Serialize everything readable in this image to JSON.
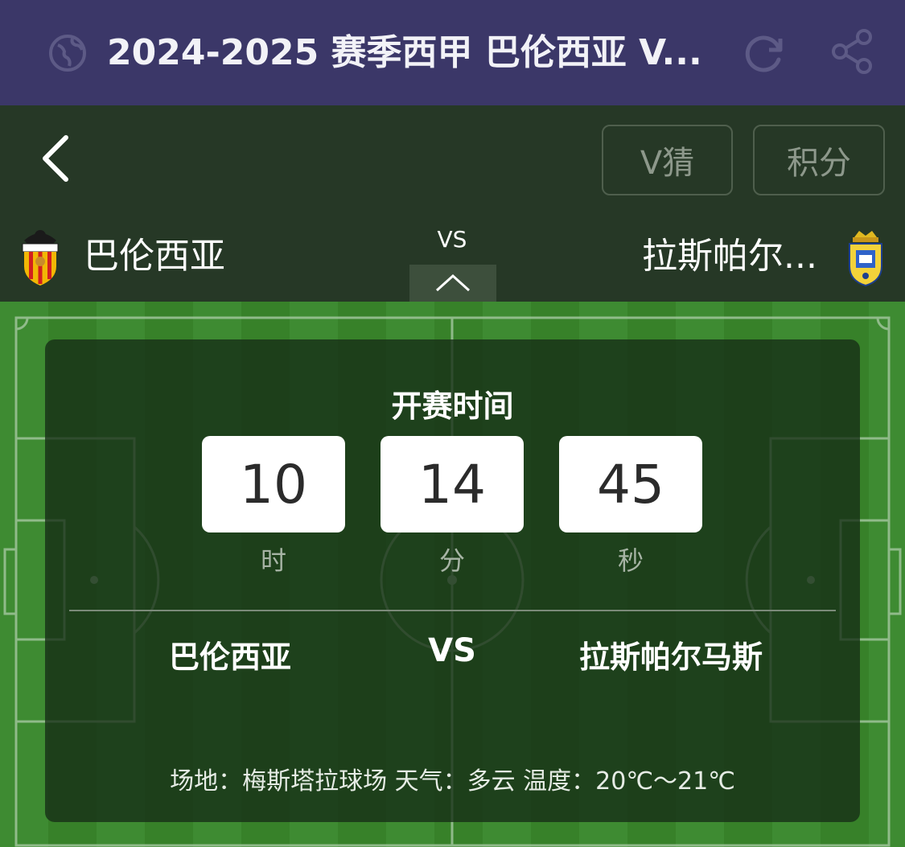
{
  "topbar": {
    "title": "2024-2025 赛季西甲 巴伦西亚 V..."
  },
  "header": {
    "guess_button": "V猜",
    "points_button": "积分",
    "vs_label": "VS",
    "home_team": "巴伦西亚",
    "away_team": "拉斯帕尔...",
    "home_logo_text": "VALENCIA C.F."
  },
  "countdown": {
    "title": "开赛时间",
    "hours": "10",
    "minutes": "14",
    "seconds": "45",
    "hours_unit": "时",
    "minutes_unit": "分",
    "seconds_unit": "秒"
  },
  "match": {
    "home_team": "巴伦西亚",
    "vs": "VS",
    "away_team": "拉斯帕尔马斯",
    "info": "场地：梅斯塔拉球场 天气：多云 温度：20℃～21℃"
  },
  "colors": {
    "title_bar": "#3b3768",
    "header_bg": "#263826",
    "pitch_light": "#3e8b32",
    "pitch_dark": "#378129"
  }
}
